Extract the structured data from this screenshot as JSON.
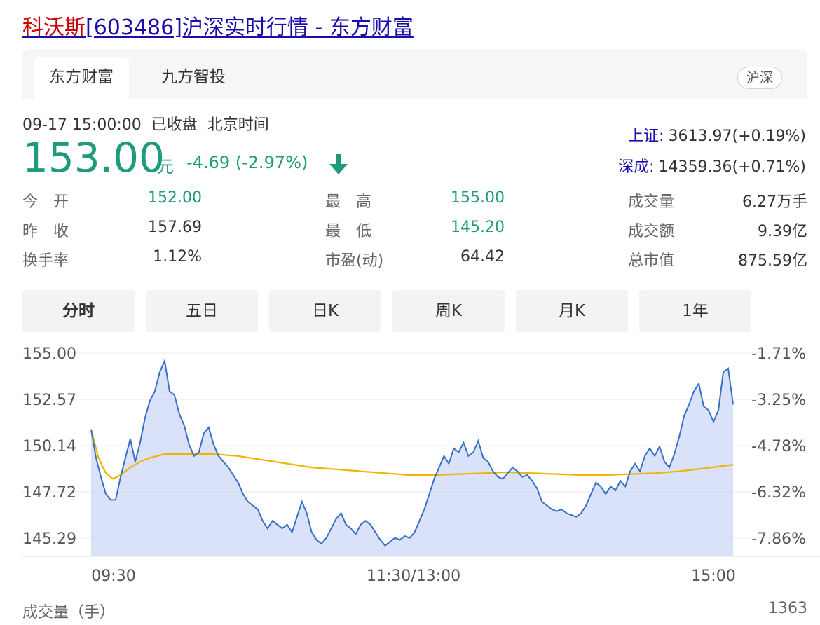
{
  "title": {
    "highlight": "科沃斯",
    "rest": "[603486]沪深实时行情 - 东方财富"
  },
  "tabs": [
    "东方财富",
    "九方智投"
  ],
  "market_badge": "沪深",
  "status": {
    "datetime": "09-17 15:00:00",
    "state": "已收盘",
    "timezone": "北京时间"
  },
  "quote": {
    "price": "153.00",
    "unit": "元",
    "change": "-4.69 (-2.97%)",
    "direction": "down",
    "color": "#1e9b7c"
  },
  "indices": [
    {
      "name": "上证:",
      "value": "3613.97(+0.19%)"
    },
    {
      "name": "深成:",
      "value": "14359.36(+0.71%)"
    }
  ],
  "stats": {
    "open_label": "今　开",
    "open": "152.00",
    "prev_label": "昨　收",
    "prev": "157.69",
    "turnover_label": "换手率",
    "turnover": "1.12%",
    "high_label": "最　高",
    "high": "155.00",
    "low_label": "最　低",
    "low": "145.20",
    "pe_label": "市盈(动)",
    "pe": "64.42",
    "volume_label": "成交量",
    "volume": "6.27万手",
    "amount_label": "成交额",
    "amount": "9.39亿",
    "mcap_label": "总市值",
    "mcap": "875.59亿"
  },
  "periods": [
    "分时",
    "五日",
    "日K",
    "周K",
    "月K",
    "1年"
  ],
  "active_period": "分时",
  "volume_footer": {
    "label": "成交量（手）",
    "value": "1363"
  },
  "chart_data": {
    "type": "line",
    "ylim": [
      144.0,
      155.0
    ],
    "y_ticks": [
      "155.00",
      "152.57",
      "150.14",
      "147.72",
      "145.29"
    ],
    "y_tick_values": [
      155.0,
      152.57,
      150.14,
      147.72,
      145.29
    ],
    "right_ticks": [
      "-1.71%",
      "-3.25%",
      "-4.78%",
      "-6.32%",
      "-7.86%"
    ],
    "x_tick_labels": [
      "09:30",
      "11:30/13:00",
      "15:00"
    ],
    "x_range_minutes": [
      0,
      240
    ],
    "series": [
      {
        "role": "price",
        "color": "#3a6fc8",
        "fill": "#c9d6f5",
        "points": [
          [
            0,
            151.0
          ],
          [
            2,
            149.5
          ],
          [
            4,
            148.5
          ],
          [
            6,
            147.6
          ],
          [
            8,
            147.3
          ],
          [
            10,
            147.3
          ],
          [
            12,
            148.5
          ],
          [
            14,
            149.5
          ],
          [
            16,
            150.5
          ],
          [
            18,
            149.3
          ],
          [
            20,
            150.3
          ],
          [
            22,
            151.6
          ],
          [
            24,
            152.5
          ],
          [
            26,
            153.0
          ],
          [
            28,
            154.0
          ],
          [
            30,
            154.6
          ],
          [
            32,
            153.0
          ],
          [
            34,
            152.8
          ],
          [
            36,
            151.8
          ],
          [
            38,
            151.2
          ],
          [
            40,
            150.2
          ],
          [
            42,
            149.6
          ],
          [
            44,
            149.8
          ],
          [
            46,
            150.8
          ],
          [
            48,
            151.1
          ],
          [
            50,
            150.2
          ],
          [
            52,
            149.6
          ],
          [
            54,
            149.3
          ],
          [
            56,
            149.0
          ],
          [
            58,
            148.6
          ],
          [
            60,
            148.2
          ],
          [
            62,
            147.6
          ],
          [
            64,
            147.2
          ],
          [
            66,
            147.0
          ],
          [
            68,
            146.8
          ],
          [
            70,
            146.2
          ],
          [
            72,
            145.8
          ],
          [
            74,
            146.2
          ],
          [
            76,
            146.0
          ],
          [
            78,
            145.8
          ],
          [
            80,
            146.0
          ],
          [
            82,
            145.6
          ],
          [
            84,
            146.4
          ],
          [
            86,
            147.2
          ],
          [
            88,
            146.6
          ],
          [
            90,
            145.6
          ],
          [
            92,
            145.2
          ],
          [
            94,
            145.0
          ],
          [
            96,
            145.3
          ],
          [
            98,
            145.8
          ],
          [
            100,
            146.3
          ],
          [
            102,
            146.6
          ],
          [
            104,
            146.0
          ],
          [
            106,
            145.8
          ],
          [
            108,
            145.5
          ],
          [
            110,
            146.0
          ],
          [
            112,
            146.2
          ],
          [
            114,
            146.0
          ],
          [
            116,
            145.6
          ],
          [
            118,
            145.2
          ],
          [
            120,
            144.9
          ],
          [
            122,
            145.1
          ],
          [
            124,
            145.3
          ],
          [
            126,
            145.2
          ],
          [
            128,
            145.4
          ],
          [
            130,
            145.3
          ],
          [
            132,
            145.6
          ],
          [
            134,
            146.2
          ],
          [
            136,
            146.8
          ],
          [
            138,
            147.6
          ],
          [
            140,
            148.4
          ],
          [
            142,
            149.0
          ],
          [
            144,
            149.6
          ],
          [
            146,
            149.2
          ],
          [
            148,
            150.0
          ],
          [
            150,
            149.8
          ],
          [
            152,
            150.3
          ],
          [
            154,
            149.6
          ],
          [
            156,
            149.8
          ],
          [
            158,
            150.4
          ],
          [
            160,
            149.5
          ],
          [
            162,
            149.3
          ],
          [
            164,
            148.8
          ],
          [
            166,
            148.5
          ],
          [
            168,
            148.4
          ],
          [
            170,
            148.7
          ],
          [
            172,
            149.0
          ],
          [
            174,
            148.8
          ],
          [
            176,
            148.5
          ],
          [
            178,
            148.6
          ],
          [
            180,
            148.3
          ],
          [
            182,
            147.9
          ],
          [
            184,
            147.2
          ],
          [
            186,
            147.0
          ],
          [
            188,
            146.8
          ],
          [
            190,
            146.7
          ],
          [
            192,
            146.8
          ],
          [
            194,
            146.6
          ],
          [
            196,
            146.5
          ],
          [
            198,
            146.4
          ],
          [
            200,
            146.6
          ],
          [
            202,
            147.0
          ],
          [
            204,
            147.6
          ],
          [
            206,
            148.2
          ],
          [
            208,
            148.0
          ],
          [
            210,
            147.6
          ],
          [
            212,
            148.0
          ],
          [
            214,
            147.8
          ],
          [
            216,
            148.3
          ],
          [
            218,
            148.0
          ],
          [
            220,
            148.8
          ],
          [
            222,
            149.2
          ],
          [
            224,
            148.8
          ],
          [
            226,
            149.6
          ],
          [
            228,
            150.0
          ],
          [
            230,
            149.6
          ],
          [
            232,
            150.1
          ],
          [
            234,
            149.3
          ],
          [
            236,
            149.0
          ],
          [
            238,
            149.7
          ],
          [
            240,
            150.6
          ],
          [
            242,
            151.7
          ],
          [
            244,
            152.3
          ],
          [
            246,
            153.0
          ],
          [
            248,
            153.4
          ],
          [
            250,
            152.2
          ],
          [
            252,
            152.0
          ],
          [
            254,
            151.4
          ],
          [
            256,
            152.0
          ],
          [
            258,
            154.0
          ],
          [
            260,
            154.2
          ],
          [
            262,
            152.3
          ]
        ]
      },
      {
        "role": "average",
        "color": "#f0b400",
        "points": [
          [
            0,
            151.0
          ],
          [
            3,
            149.5
          ],
          [
            6,
            148.7
          ],
          [
            9,
            148.4
          ],
          [
            12,
            148.6
          ],
          [
            16,
            149.0
          ],
          [
            20,
            149.3
          ],
          [
            24,
            149.5
          ],
          [
            30,
            149.7
          ],
          [
            40,
            149.7
          ],
          [
            50,
            149.7
          ],
          [
            60,
            149.6
          ],
          [
            70,
            149.4
          ],
          [
            80,
            149.2
          ],
          [
            90,
            149.0
          ],
          [
            100,
            148.9
          ],
          [
            110,
            148.8
          ],
          [
            120,
            148.7
          ],
          [
            130,
            148.6
          ],
          [
            140,
            148.6
          ],
          [
            150,
            148.65
          ],
          [
            160,
            148.7
          ],
          [
            170,
            148.75
          ],
          [
            180,
            148.7
          ],
          [
            190,
            148.65
          ],
          [
            200,
            148.6
          ],
          [
            210,
            148.6
          ],
          [
            220,
            148.65
          ],
          [
            230,
            148.7
          ],
          [
            240,
            148.8
          ],
          [
            250,
            148.95
          ],
          [
            262,
            149.15
          ]
        ]
      }
    ]
  }
}
